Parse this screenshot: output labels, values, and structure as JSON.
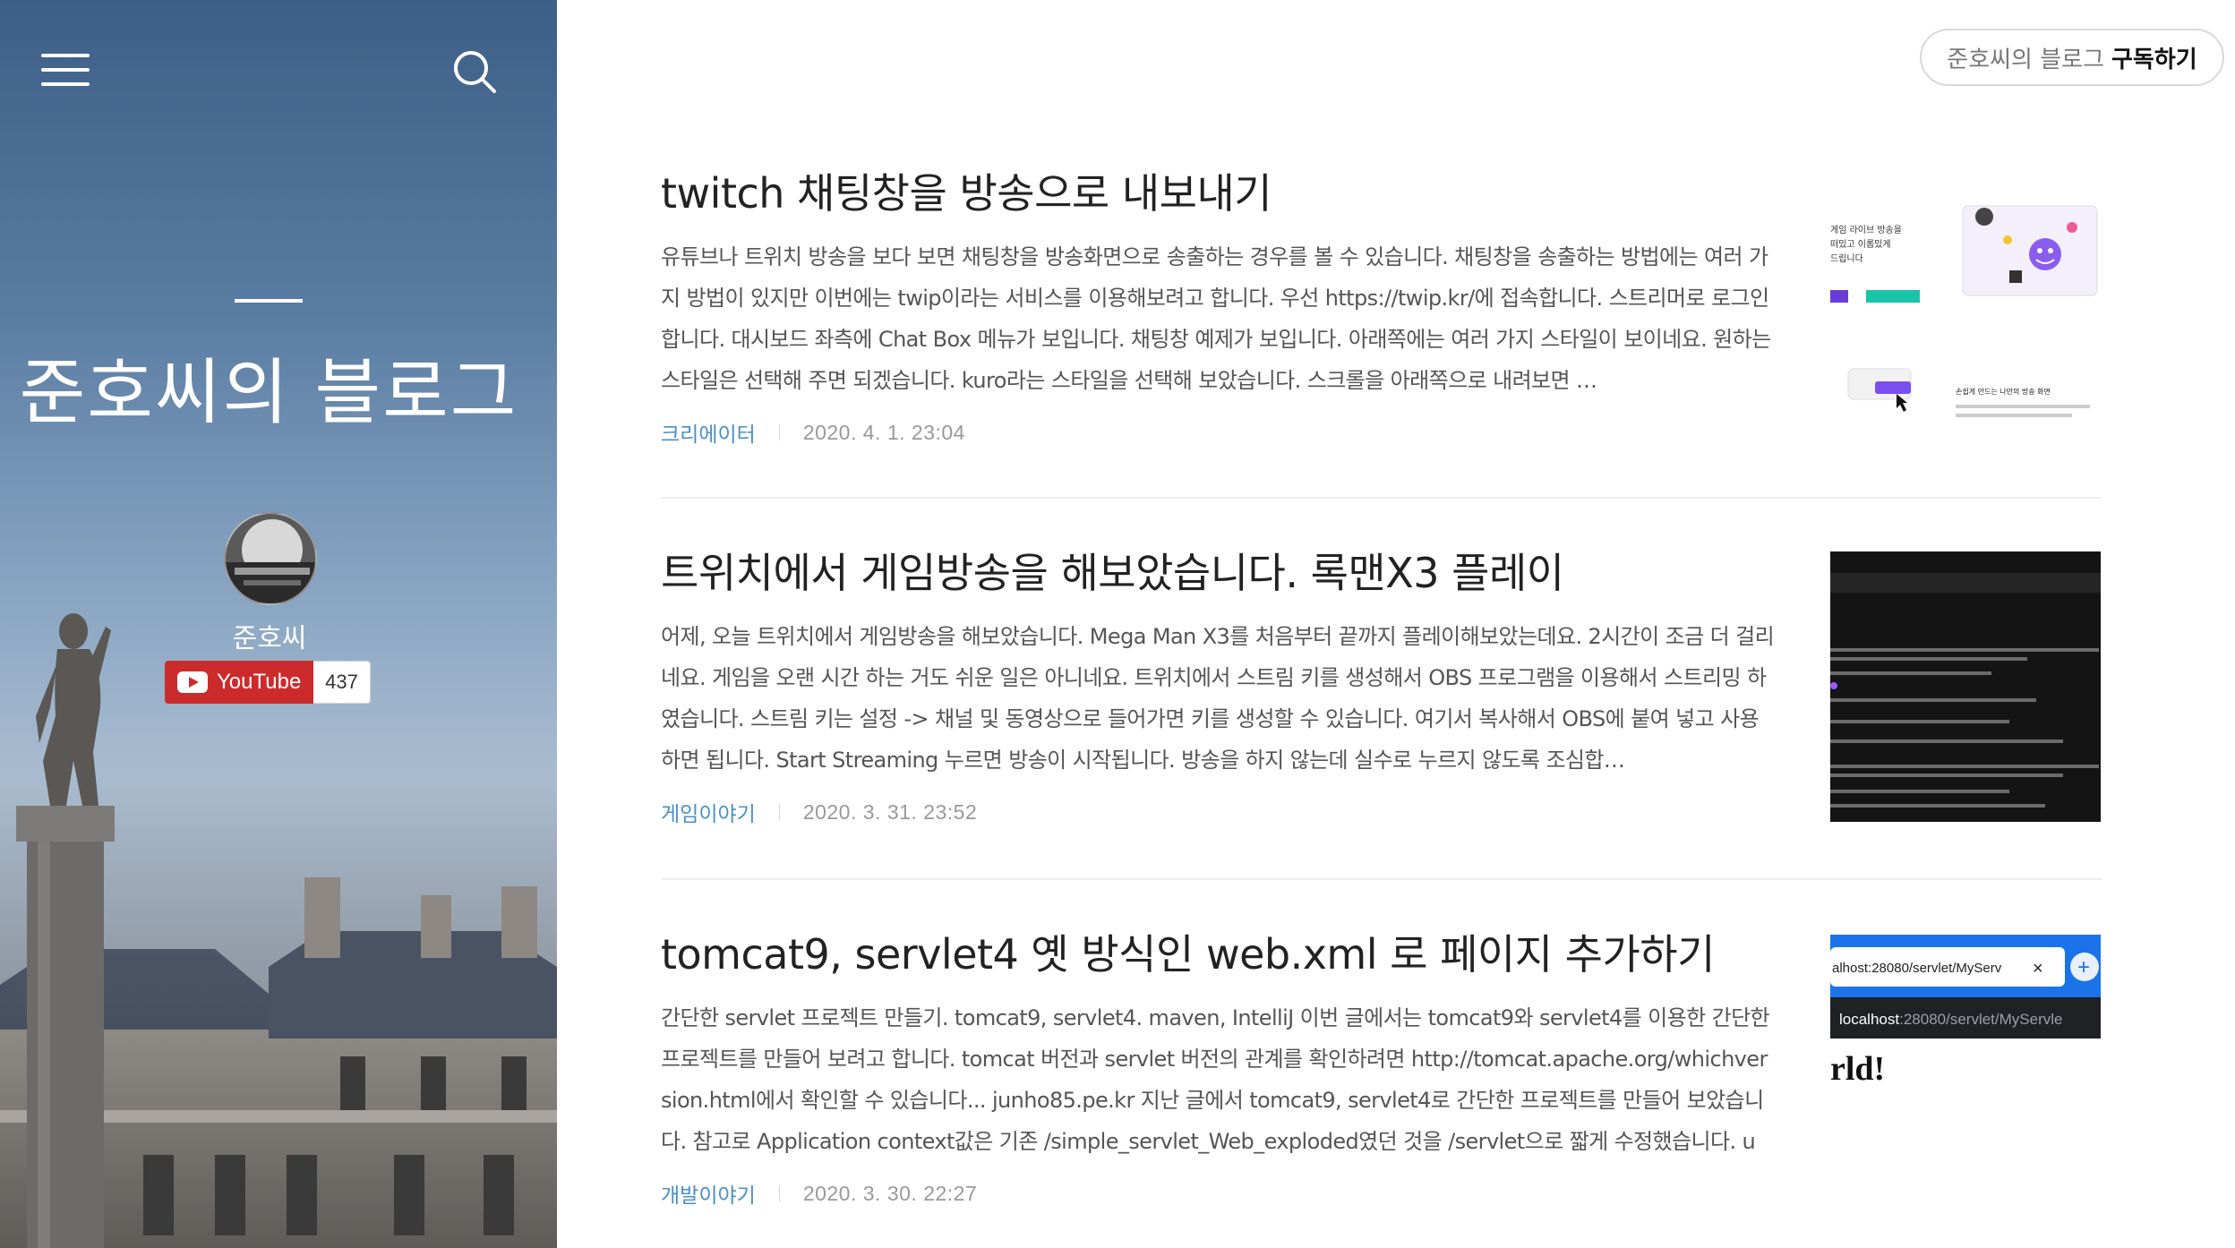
{
  "sidebar": {
    "title": "준호씨의 블로그",
    "author": "준호씨",
    "youtube": {
      "label": "YouTube",
      "count": "437"
    }
  },
  "header": {
    "subscribe": {
      "blog": "준호씨의 블로그",
      "action": "구독하기"
    }
  },
  "posts": [
    {
      "title": "twitch 채팅창을 방송으로 내보내기",
      "excerpt": "유튜브나 트위치 방송을 보다 보면 채팅창을 방송화면으로 송출하는 경우를 볼 수 있습니다. 채팅창을 송출하는 방법에는 여러 가지 방법이 있지만 이번에는 twip이라는 서비스를 이용해보려고 합니다. 우선 https://twip.kr/에 접속합니다. 스트리머로 로그인합니다. 대시보드 좌측에 Chat Box 메뉴가 보입니다. 채팅창 예제가 보입니다. 아래쪽에는 여러 가지 스타일이 보이네요. 원하는 스타일은 선택해 주면 되겠습니다. kuro라는 스타일을 선택해 보았습니다. 스크롤을 아래쪽으로 내려보면 …",
      "category": "크리에이터",
      "date": "2020. 4. 1. 23:04",
      "thumb_text": [
        "게임 라이브 방송을",
        "떠밌고 이롭밌게",
        "드립니다",
        "손쉽게 만드는 나만의 방송 화면"
      ]
    },
    {
      "title": "트위치에서 게임방송을 해보았습니다. 록맨X3 플레이",
      "excerpt": "어제, 오늘 트위치에서 게임방송을 해보았습니다. Mega Man X3를 처음부터 끝까지 플레이해보았는데요. 2시간이 조금 더 걸리네요. 게임을 오랜 시간 하는 거도 쉬운 일은 아니네요. 트위치에서 스트림 키를 생성해서 OBS 프로그램을 이용해서 스트리밍 하였습니다. 스트림 키는 설정 -> 채널 및 동영상으로 들어가면 키를 생성할 수 있습니다. 여기서 복사해서 OBS에 붙여 넣고 사용하면 됩니다. Start Streaming 누르면 방송이 시작됩니다. 방송을 하지 않는데 실수로 누르지 않도록 조심합…",
      "category": "게임이야기",
      "date": "2020. 3. 31. 23:52"
    },
    {
      "title": "tomcat9, servlet4 옛 방식인 web.xml 로 페이지 추가하기",
      "excerpt": "간단한 servlet 프로젝트 만들기. tomcat9, servlet4. maven, IntelliJ 이번 글에서는 tomcat9와 servlet4를 이용한 간단한 프로젝트를 만들어 보려고 합니다. tomcat 버전과 servlet 버전의 관계를 확인하려면 http://tomcat.apache.org/whichversion.html에서 확인할 수 있습니다... junho85.pe.kr 지난 글에서 tomcat9, servlet4로 간단한 프로젝트를 만들어 보았습니다. 참고로 Application context값은 기존 /simple_servlet_Web_exploded였던 것을 /servlet으로 짧게 수정했습니다. ur…",
      "category": "개발이야기",
      "date": "2020. 3. 30. 22:27",
      "thumb_text": {
        "tab": "alhost:28080/servlet/MyServ",
        "close": "×",
        "plus": "+",
        "url_host": "localhost",
        "url_path": ":28080/servlet/MyServle",
        "big": "rld!"
      }
    }
  ]
}
